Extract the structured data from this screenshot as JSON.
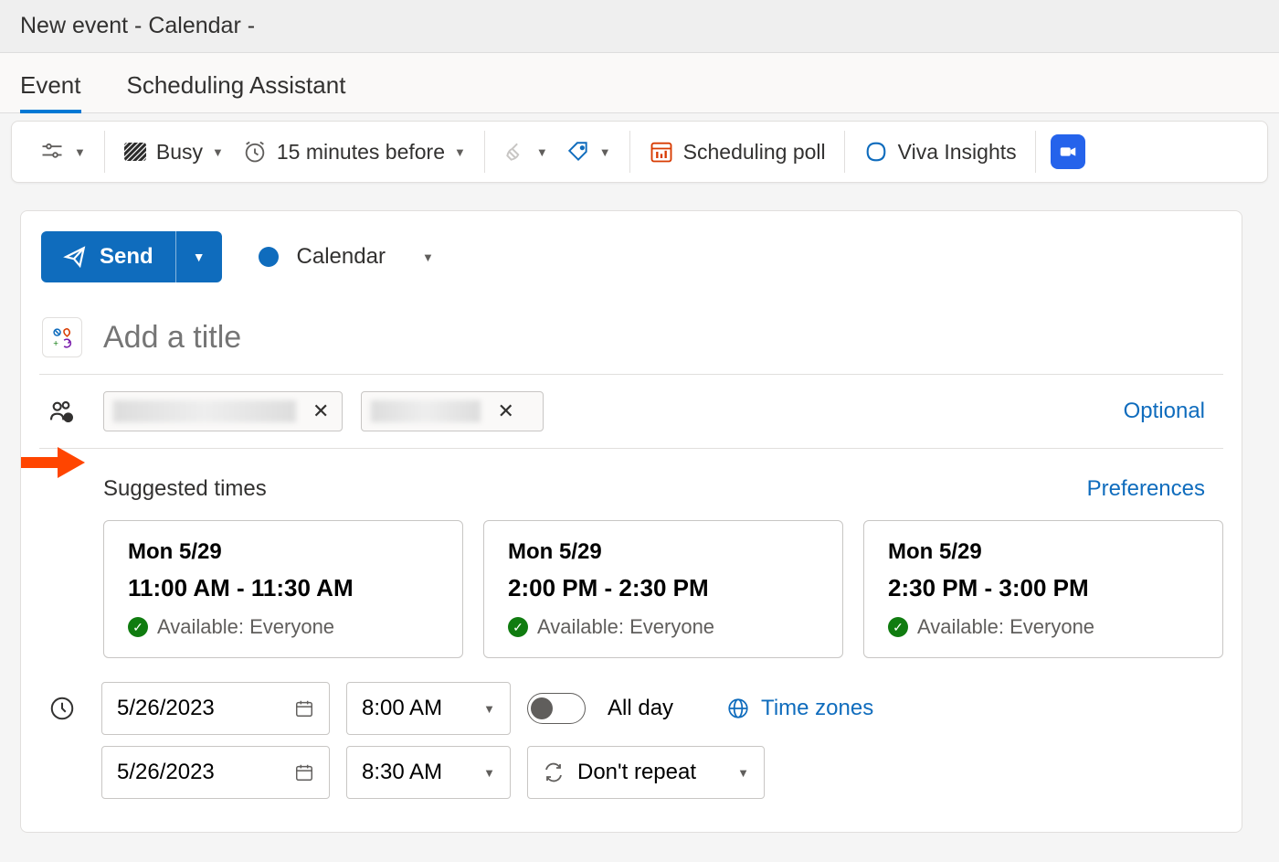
{
  "window": {
    "title": "New event - Calendar - "
  },
  "tabs": {
    "event": "Event",
    "scheduling_assistant": "Scheduling Assistant"
  },
  "toolbar": {
    "status": "Busy",
    "reminder": "15 minutes before",
    "scheduling_poll": "Scheduling poll",
    "viva": "Viva Insights"
  },
  "send": {
    "label": "Send"
  },
  "calendar": {
    "label": "Calendar"
  },
  "title": {
    "placeholder": "Add a title"
  },
  "attendees": {
    "optional_label": "Optional"
  },
  "suggested": {
    "label": "Suggested times",
    "preferences": "Preferences",
    "slots": [
      {
        "date": "Mon 5/29",
        "time": "11:00 AM - 11:30 AM",
        "availability": "Available: Everyone"
      },
      {
        "date": "Mon 5/29",
        "time": "2:00 PM - 2:30 PM",
        "availability": "Available: Everyone"
      },
      {
        "date": "Mon 5/29",
        "time": "2:30 PM - 3:00 PM",
        "availability": "Available: Everyone"
      }
    ]
  },
  "datetime": {
    "start_date": "5/26/2023",
    "start_time": "8:00 AM",
    "end_date": "5/26/2023",
    "end_time": "8:30 AM",
    "all_day": "All day",
    "time_zones": "Time zones",
    "repeat": "Don't repeat"
  }
}
